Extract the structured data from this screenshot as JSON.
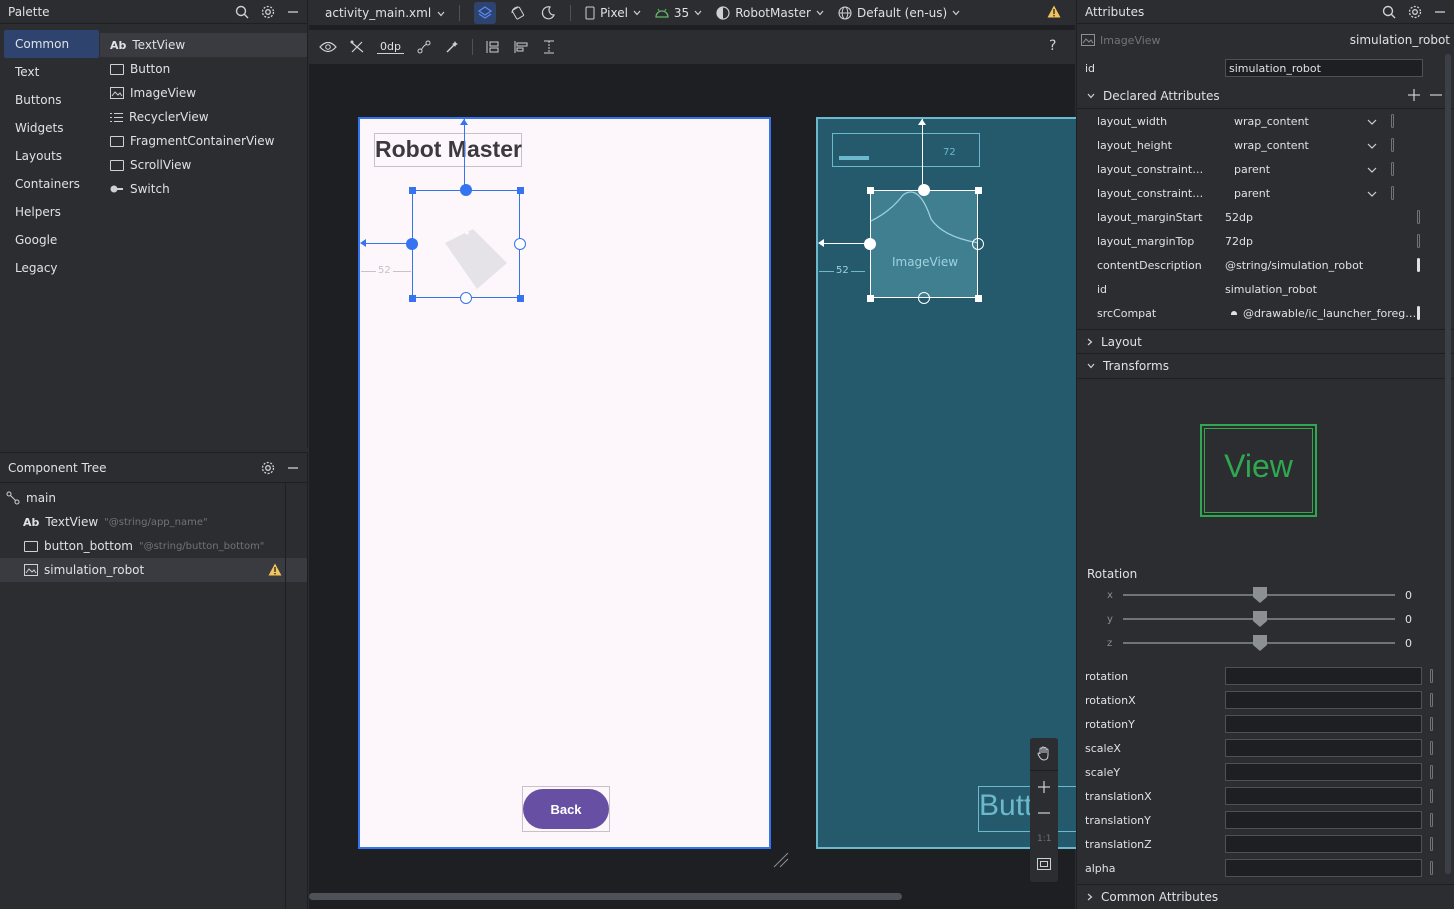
{
  "palette": {
    "title": "Palette",
    "categories": [
      "Common",
      "Text",
      "Buttons",
      "Widgets",
      "Layouts",
      "Containers",
      "Helpers",
      "Google",
      "Legacy"
    ],
    "items": [
      {
        "icon": "textview-icon",
        "prefix": "Ab",
        "label": "TextView"
      },
      {
        "icon": "button-icon",
        "prefix": "",
        "label": "Button"
      },
      {
        "icon": "imageview-icon",
        "prefix": "",
        "label": "ImageView"
      },
      {
        "icon": "recyclerview-icon",
        "prefix": "",
        "label": "RecyclerView"
      },
      {
        "icon": "fragment-icon",
        "prefix": "",
        "label": "FragmentContainerView"
      },
      {
        "icon": "scrollview-icon",
        "prefix": "",
        "label": "ScrollView"
      },
      {
        "icon": "switch-icon",
        "prefix": "",
        "label": "Switch"
      }
    ]
  },
  "component_tree": {
    "title": "Component Tree",
    "root": "main",
    "items": [
      {
        "prefix": "Ab",
        "label": "TextView",
        "hint": "\"@string/app_name\""
      },
      {
        "prefix": "",
        "label": "button_bottom",
        "hint": "\"@string/button_bottom\""
      },
      {
        "prefix": "",
        "label": "simulation_robot",
        "hint": ""
      }
    ]
  },
  "toolbar": {
    "file": "activity_main.xml",
    "device": "Pixel",
    "api": "35",
    "theme": "RobotMaster",
    "locale": "Default (en-us)",
    "margin": "0dp",
    "help": "?"
  },
  "design": {
    "title_text": "Robot Master",
    "back_button": "Back",
    "margin_start": "52",
    "margin_top": "72",
    "blueprint_imageview": "ImageView",
    "blueprint_button": "Butt"
  },
  "zoom": {
    "ratio": "1:1"
  },
  "attributes": {
    "title": "Attributes",
    "component_type": "ImageView",
    "component_id": "simulation_robot",
    "id_label": "id",
    "id_value": "simulation_robot",
    "declared_title": "Declared Attributes",
    "declared": [
      {
        "name": "layout_width",
        "value": "wrap_content",
        "dropdown": true
      },
      {
        "name": "layout_height",
        "value": "wrap_content",
        "dropdown": true
      },
      {
        "name": "layout_constraintStart_t...",
        "value": "parent",
        "dropdown": true
      },
      {
        "name": "layout_constraintTop_to...",
        "value": "parent",
        "dropdown": true
      },
      {
        "name": "layout_marginStart",
        "value": "52dp",
        "dropdown": false
      },
      {
        "name": "layout_marginTop",
        "value": "72dp",
        "dropdown": false
      },
      {
        "name": "contentDescription",
        "value": "@string/simulation_robot",
        "dropdown": false
      },
      {
        "name": "id",
        "value": "simulation_robot",
        "dropdown": false
      },
      {
        "name": "srcCompat",
        "value": "@drawable/ic_launcher_foregro...",
        "dropdown": false
      }
    ],
    "layout_title": "Layout",
    "transforms_title": "Transforms",
    "view_preview": "View",
    "rotation_title": "Rotation",
    "rotation_axes": [
      {
        "axis": "x",
        "value": "0"
      },
      {
        "axis": "y",
        "value": "0"
      },
      {
        "axis": "z",
        "value": "0"
      }
    ],
    "transform_fields": [
      "rotation",
      "rotationX",
      "rotationY",
      "scaleX",
      "scaleY",
      "translationX",
      "translationY",
      "translationZ",
      "alpha"
    ],
    "common_title": "Common Attributes"
  },
  "colors": {
    "accent": "#3574f0",
    "warning": "#f2c55c",
    "back_button": "#6750a4",
    "blueprint": "#245a6b",
    "view_preview": "#2fa84f"
  }
}
